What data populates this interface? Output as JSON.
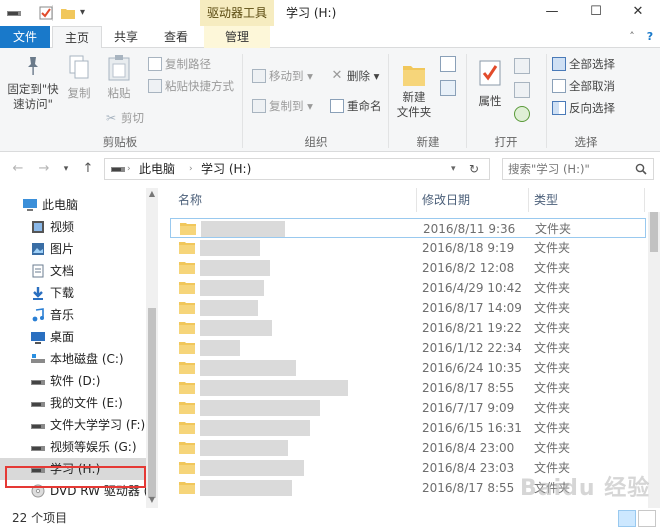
{
  "titlebar": {
    "contextual_tab": "驱动器工具",
    "title": "学习 (H:)",
    "controls": [
      "minimize",
      "maximize",
      "close"
    ]
  },
  "tabs": {
    "file": "文件",
    "home": "主页",
    "share": "共享",
    "view": "查看",
    "manage": "管理"
  },
  "ribbon": {
    "clipboard": {
      "pin": "固定到\"快速访问\"",
      "pin_line1": "固定到\"快",
      "pin_line2": "速访问\"",
      "copy": "复制",
      "paste": "粘贴",
      "copy_path": "复制路径",
      "paste_shortcut": "粘贴快捷方式",
      "cut": "剪切",
      "label": "剪贴板"
    },
    "organize": {
      "move_to": "移动到",
      "copy_to": "复制到",
      "delete": "删除",
      "rename": "重命名",
      "label": "组织"
    },
    "new": {
      "new_folder_line1": "新建",
      "new_folder_line2": "文件夹",
      "label": "新建"
    },
    "open": {
      "properties": "属性",
      "label": "打开"
    },
    "select": {
      "select_all": "全部选择",
      "select_none": "全部取消",
      "invert": "反向选择",
      "label": "选择"
    }
  },
  "address": {
    "crumbs": [
      "此电脑",
      "学习 (H:)"
    ],
    "search_placeholder": "搜索\"学习 (H:)\""
  },
  "sidebar": {
    "items": [
      {
        "label": "此电脑",
        "icon": "computer-icon",
        "indent": 0
      },
      {
        "label": "视频",
        "icon": "video-folder-icon",
        "indent": 1
      },
      {
        "label": "图片",
        "icon": "pictures-folder-icon",
        "indent": 1
      },
      {
        "label": "文档",
        "icon": "documents-folder-icon",
        "indent": 1
      },
      {
        "label": "下载",
        "icon": "download-icon",
        "indent": 1
      },
      {
        "label": "音乐",
        "icon": "music-icon",
        "indent": 1
      },
      {
        "label": "桌面",
        "icon": "desktop-folder-icon",
        "indent": 1
      },
      {
        "label": "本地磁盘 (C:)",
        "icon": "windows-drive-icon",
        "indent": 1
      },
      {
        "label": "软件 (D:)",
        "icon": "drive-icon",
        "indent": 1
      },
      {
        "label": "我的文件 (E:)",
        "icon": "drive-icon",
        "indent": 1
      },
      {
        "label": "文件大学学习 (F:)",
        "icon": "drive-icon",
        "indent": 1
      },
      {
        "label": "视频等娱乐 (G:)",
        "icon": "drive-icon",
        "indent": 1
      },
      {
        "label": "学习 (H:)",
        "icon": "drive-icon",
        "indent": 1,
        "selected": true
      },
      {
        "label": "DVD RW 驱动器 (",
        "icon": "dvd-drive-icon",
        "indent": 1
      }
    ]
  },
  "filelist": {
    "columns": {
      "name": "名称",
      "date": "修改日期",
      "type": "类型"
    },
    "rows": [
      {
        "date": "2016/8/11 9:36",
        "type": "文件夹"
      },
      {
        "date": "2016/8/18 9:19",
        "type": "文件夹"
      },
      {
        "date": "2016/8/2 12:08",
        "type": "文件夹"
      },
      {
        "date": "2016/4/29 10:42",
        "type": "文件夹"
      },
      {
        "date": "2016/8/17 14:09",
        "type": "文件夹"
      },
      {
        "date": "2016/8/21 19:22",
        "type": "文件夹"
      },
      {
        "date": "2016/1/12 22:34",
        "type": "文件夹"
      },
      {
        "date": "2016/6/24 10:35",
        "type": "文件夹"
      },
      {
        "date": "2016/8/17 8:55",
        "type": "文件夹"
      },
      {
        "date": "2016/7/17 9:09",
        "type": "文件夹"
      },
      {
        "date": "2016/6/15 16:31",
        "type": "文件夹"
      },
      {
        "date": "2016/8/4 23:00",
        "type": "文件夹"
      },
      {
        "date": "2016/8/4 23:03",
        "type": "文件夹"
      },
      {
        "date": "2016/8/17 8:55",
        "type": "文件夹"
      }
    ]
  },
  "status": {
    "count": "22 个项目"
  },
  "watermark": "Baidu 经验",
  "colors": {
    "file_tab": "#1979ca",
    "context_tab": "#f6ecc0",
    "folder": "#f1c75b",
    "selection_box": "#e53935"
  }
}
